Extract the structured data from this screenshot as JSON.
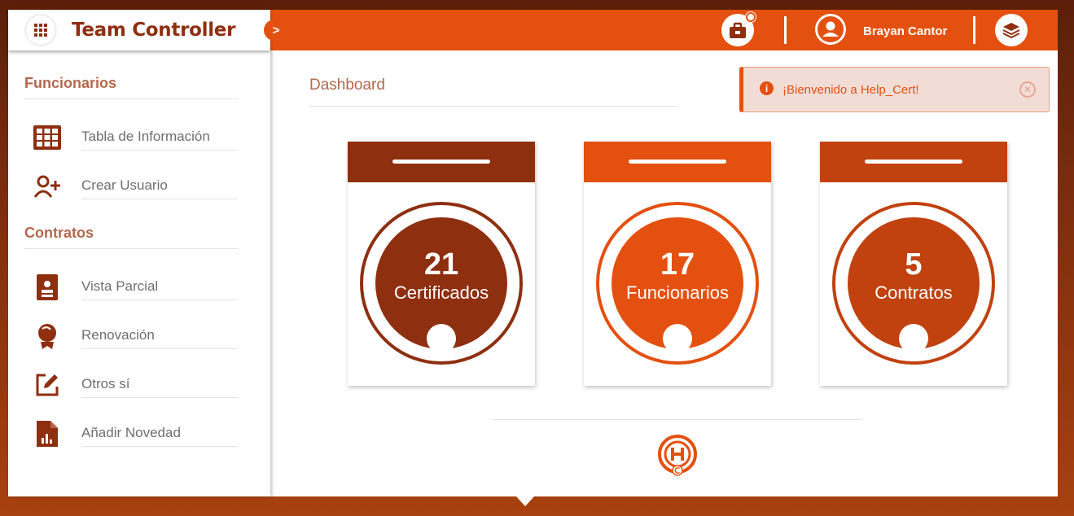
{
  "app": {
    "title": "Team Controller",
    "toggle_label": ">"
  },
  "header": {
    "user_name": "Brayan Cantor"
  },
  "sidebar": {
    "sections": [
      {
        "title": "Funcionarios",
        "items": [
          {
            "label": "Tabla de Información",
            "icon": "table-icon"
          },
          {
            "label": "Crear Usuario",
            "icon": "add-user-icon"
          }
        ]
      },
      {
        "title": "Contratos",
        "items": [
          {
            "label": "Vista Parcial",
            "icon": "badge-icon"
          },
          {
            "label": "Renovación",
            "icon": "award-icon"
          },
          {
            "label": "Otros sí",
            "icon": "edit-icon"
          },
          {
            "label": "Añadir Novedad",
            "icon": "report-file-icon"
          }
        ]
      }
    ]
  },
  "main": {
    "title": "Dashboard",
    "toast": {
      "message": "¡Bienvenido a Help_Cert!",
      "info_glyph": "i",
      "close_glyph": "×"
    },
    "cards": [
      {
        "value": "21",
        "label": "Certificados",
        "color": "#8e2f10"
      },
      {
        "value": "17",
        "label": "Funcionarios",
        "color": "#e4500f"
      },
      {
        "value": "5",
        "label": "Contratos",
        "color": "#c1410f"
      }
    ]
  },
  "colors": {
    "accent": "#e4500f",
    "brand_dark": "#8e2f10",
    "section_title": "#b4674c"
  }
}
